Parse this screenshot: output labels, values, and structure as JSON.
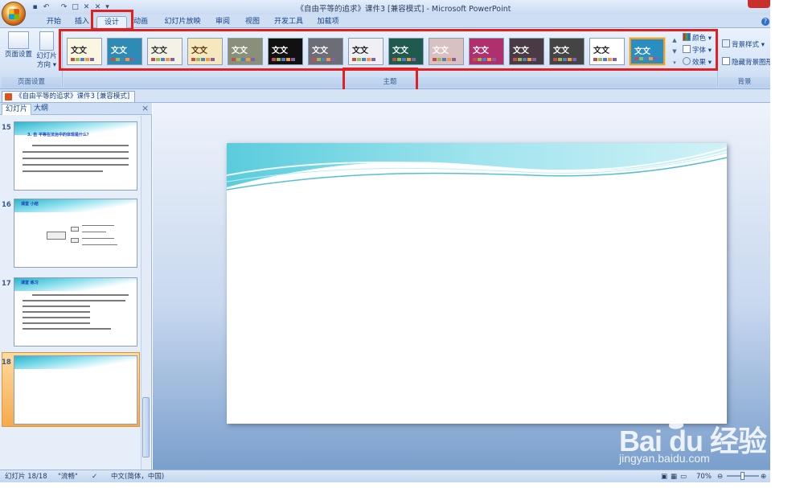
{
  "window": {
    "title": "《自由平等的追求》课件3 [兼容模式] - Microsoft PowerPoint"
  },
  "tabs": [
    {
      "label": "开始"
    },
    {
      "label": "插入"
    },
    {
      "label": "设计",
      "active": true
    },
    {
      "label": "动画"
    },
    {
      "label": "幻灯片放映"
    },
    {
      "label": "审阅"
    },
    {
      "label": "视图"
    },
    {
      "label": "开发工具"
    },
    {
      "label": "加载项"
    }
  ],
  "ribbon": {
    "page_setup_group": {
      "page_setup_label": "页面设置",
      "orientation_label_1": "幻灯片",
      "orientation_label_2": "方向",
      "group_label": "页面设置"
    },
    "themes_group": {
      "group_label": "主题",
      "theme_text": "文文",
      "themes": [
        {
          "bg": "#fbf6e0",
          "fg": "#2a2a2a"
        },
        {
          "bg": "#2d8bb6",
          "fg": "#ffffff"
        },
        {
          "bg": "#f4f1e6",
          "fg": "#333333"
        },
        {
          "bg": "#f6e7bd",
          "fg": "#5a3c10"
        },
        {
          "bg": "#8a8f7a",
          "fg": "#ffffff"
        },
        {
          "bg": "#111111",
          "fg": "#ffffff"
        },
        {
          "bg": "#6d6d78",
          "fg": "#ffffff"
        },
        {
          "bg": "#f0f0f4",
          "fg": "#222222"
        },
        {
          "bg": "#1f5a4e",
          "fg": "#ffffff"
        },
        {
          "bg": "#d9c1c1",
          "fg": "#ffffff"
        },
        {
          "bg": "#b0306e",
          "fg": "#ffffff"
        },
        {
          "bg": "#4a3a44",
          "fg": "#ffffff"
        },
        {
          "bg": "#444444",
          "fg": "#ffffff"
        },
        {
          "bg": "#ffffff",
          "fg": "#222222"
        },
        {
          "bg": "#2a8ec2",
          "fg": "#ffffff",
          "selected": true
        }
      ],
      "colors_label": "颜色",
      "fonts_label": "字体",
      "effects_label": "效果"
    },
    "background_group": {
      "background_styles_label": "背景样式",
      "hide_background_label": "隐藏背景图形",
      "group_label": "背景"
    }
  },
  "doc_tab": {
    "label": "《自由平等的追求》课件3 [兼容模式]"
  },
  "left_panel": {
    "tab_slides": "幻灯片",
    "tab_outline": "大纲",
    "close": "×",
    "slides": [
      {
        "number": "15",
        "title": "3. 自 平等在法治中的体现是什么？"
      },
      {
        "number": "16",
        "title": "课堂 小结"
      },
      {
        "number": "17",
        "title": "课堂 练习"
      },
      {
        "number": "18",
        "title": "",
        "selected": true
      }
    ]
  },
  "status_bar": {
    "slide_info": "幻灯片 18/18",
    "theme_name": "\"流畅\"",
    "language": "中文(简体，中国)",
    "zoom": "70%"
  },
  "watermark": {
    "brand": "Bai du 经验",
    "url": "jingyan.baidu.com"
  },
  "colors": {
    "highlight_red": "#e41f1f",
    "ribbon_blue": "#15428b"
  }
}
